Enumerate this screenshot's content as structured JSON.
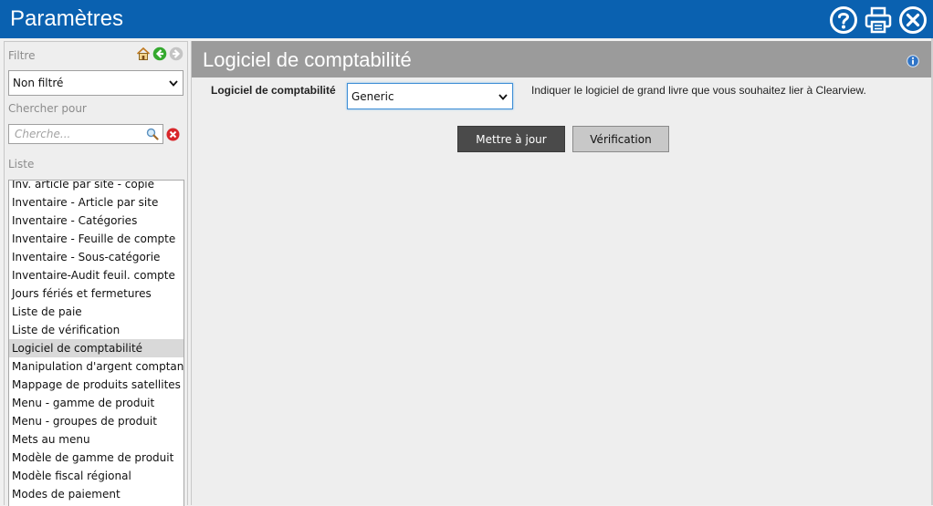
{
  "window": {
    "title": "Paramètres",
    "buttons": [
      {
        "name": "help-icon"
      },
      {
        "name": "print-icon"
      },
      {
        "name": "close-icon"
      }
    ]
  },
  "sidebar": {
    "filter_label": "Filtre",
    "nav_icons": [
      "home-icon",
      "back-arrow-icon",
      "forward-arrow-icon"
    ],
    "filter_value": "Non filtré",
    "search_label": "Chercher pour",
    "search_placeholder": "Cherche...",
    "list_label": "Liste",
    "items": [
      "Inv. article par site - copie",
      "Inventaire - Article par site",
      "Inventaire - Catégories",
      "Inventaire - Feuille de compte",
      "Inventaire - Sous-catégorie",
      "Inventaire-Audit feuil. compte",
      "Jours fériés et fermetures",
      "Liste de paie",
      "Liste de vérification",
      "Logiciel de comptabilité",
      "Manipulation d'argent comptant",
      "Mappage de produits satellites",
      "Menu - gamme de produit",
      "Menu - groupes de produit",
      "Mets au menu",
      "Modèle de gamme de produit",
      "Modèle fiscal régional",
      "Modes de paiement"
    ],
    "selected_item": "Logiciel de comptabilité"
  },
  "main": {
    "title": "Logiciel de comptabilité",
    "field_label": "Logiciel de comptabilité",
    "field_value": "Generic",
    "field_help": "Indiquer le logiciel de grand livre que vous souhaitez lier à Clearview.",
    "update_button": "Mettre à jour",
    "verify_button": "Vérification"
  },
  "colors": {
    "titlebar": "#0a61b0",
    "header": "#9b9b9b",
    "update_button": "#4a4a4a",
    "selected_row": "#d9d9d9"
  }
}
